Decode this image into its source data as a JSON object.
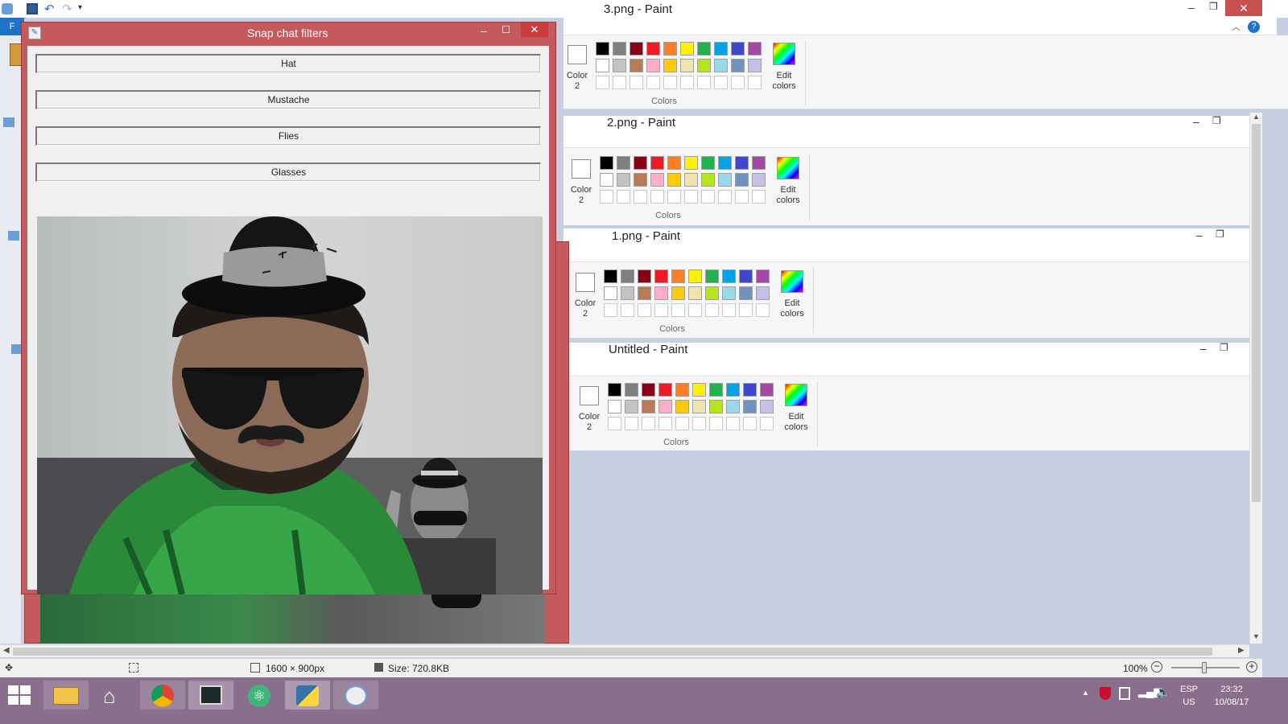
{
  "app": {
    "title": "3.png - Paint",
    "help_icon": "help-icon"
  },
  "paint_windows": [
    {
      "title": "3.png - Paint"
    },
    {
      "title": "2.png - Paint"
    },
    {
      "title": "1.png - Paint"
    },
    {
      "title": "Untitled - Paint"
    }
  ],
  "colors_group": {
    "color2_line1": "Color",
    "color2_line2": "2",
    "edit_line1": "Edit",
    "edit_line2": "colors",
    "group_label": "Colors"
  },
  "palette": [
    "#000000",
    "#7f7f7f",
    "#880015",
    "#ed1c24",
    "#ff7f27",
    "#fff200",
    "#22b14c",
    "#00a2e8",
    "#3f48cc",
    "#a349a4",
    "#ffffff",
    "#c3c3c3",
    "#b97a57",
    "#ffaec9",
    "#ffc90e",
    "#efe4b0",
    "#b5e61d",
    "#99d9ea",
    "#7092be",
    "#c8bfe7"
  ],
  "snap_window": {
    "title": "Snap chat filters",
    "buttons": [
      {
        "label": "Hat"
      },
      {
        "label": "Mustache"
      },
      {
        "label": "Flies"
      },
      {
        "label": "Glasses"
      }
    ]
  },
  "status": {
    "dimensions": "1600 × 900px",
    "size": "Size: 720.8KB",
    "zoom": "100%"
  },
  "tray": {
    "lang": "ESP",
    "region": "US",
    "time": "23:32",
    "date": "10/08/17"
  },
  "taskbar_apps": [
    "windows-start-icon",
    "file-explorer-icon",
    "home-icon",
    "chrome-icon",
    "terminal-icon",
    "atom-icon",
    "python-icon",
    "paint-icon"
  ]
}
